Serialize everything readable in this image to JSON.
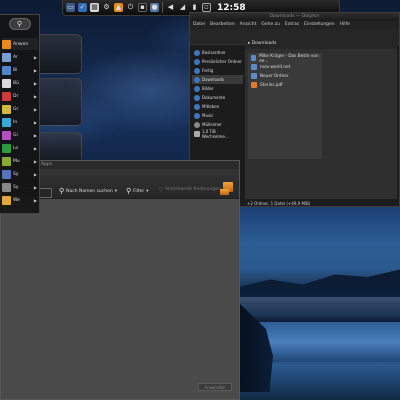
{
  "top_panel": {
    "clock": "12:58",
    "icons": [
      "display-icon",
      "check-icon",
      "calendar-icon",
      "gear-icon",
      "bag-icon",
      "power-icon",
      "terminal-icon",
      "chat-icon",
      "volume-icon",
      "network-icon"
    ]
  },
  "launcher": {
    "search_icon": "search-icon",
    "items": [
      {
        "label": "Anwen",
        "color": "#e8891b"
      },
      {
        "label": "Ar",
        "color": "#7a9fd8"
      },
      {
        "label": "Bi",
        "color": "#4f86d0"
      },
      {
        "label": "Bü",
        "color": "#d9d9d9"
      },
      {
        "label": "Dr",
        "color": "#cc3a3a"
      },
      {
        "label": "Gr",
        "color": "#d8b53b"
      },
      {
        "label": "In",
        "color": "#3aa8d8"
      },
      {
        "label": "Gi",
        "color": "#b94bc9"
      },
      {
        "label": "Le",
        "color": "#2f9a3f"
      },
      {
        "label": "Mu",
        "color": "#88aa33"
      },
      {
        "label": "Sy",
        "color": "#5572c0"
      },
      {
        "label": "Sy",
        "color": "#888888"
      },
      {
        "label": "We",
        "color": "#e6a43a"
      }
    ]
  },
  "dolphin": {
    "title": "Downloads — Dolphin",
    "menu": [
      "Datei",
      "Bearbeiten",
      "Ansicht",
      "Gehe zu",
      "Extras",
      "Einstellungen",
      "Hilfe"
    ],
    "places": [
      {
        "label": "Basisordner"
      },
      {
        "label": "Persönlicher Ordner"
      },
      {
        "label": "Fertig"
      },
      {
        "label": "Downloads"
      },
      {
        "label": "Bilder"
      },
      {
        "label": "Dokumente"
      },
      {
        "label": "Mitleben"
      },
      {
        "label": "Music"
      },
      {
        "label": "Mülleimer"
      },
      {
        "label": "1,0 TiB Wechselme..."
      }
    ],
    "selected_place_index": 3,
    "breadcrumb": "Downloads",
    "files": [
      {
        "name": "Mike Krüger - Das Beste von ee...",
        "kind": "folder"
      },
      {
        "name": "mov-world.net",
        "kind": "folder"
      },
      {
        "name": "Neuer Ordner",
        "kind": "folder"
      },
      {
        "name": "Stories.pdf",
        "kind": "pdf"
      }
    ],
    "status": "+2 Ordner, 1 Datei (+49,9 MiB)"
  },
  "search_window": {
    "title": "Apps",
    "search_by": "Nach Namen suchen",
    "filter": "Filter",
    "pending_apply": "Anstehende Änderungen",
    "apply": "Anwenden"
  },
  "colors": {
    "accent": "#e8891b",
    "folder": "#5b8bc9"
  }
}
